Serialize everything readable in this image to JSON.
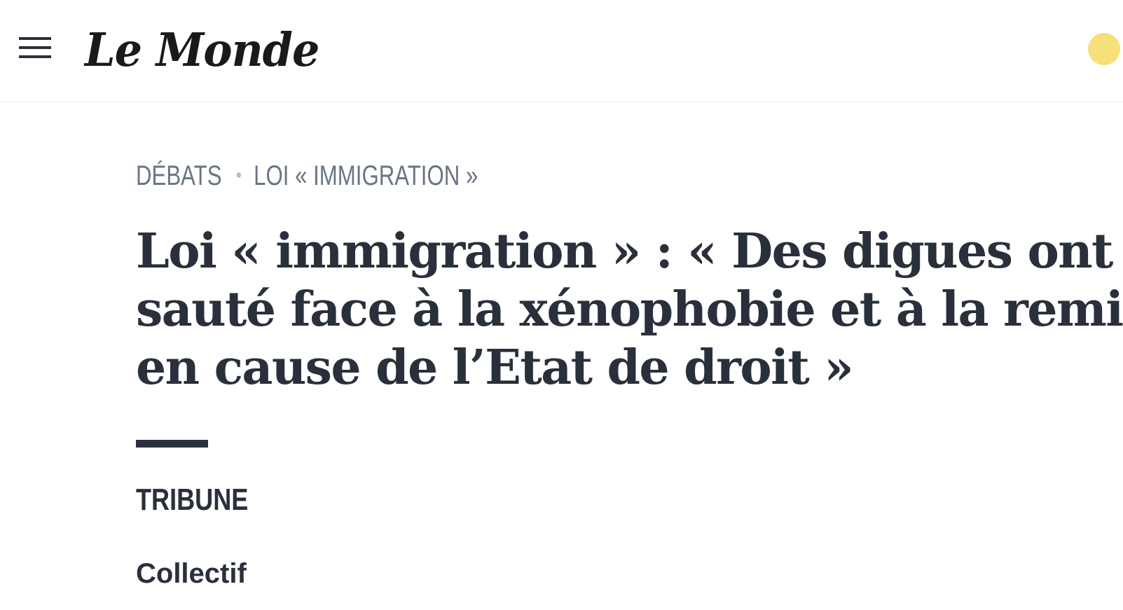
{
  "header": {
    "menu_icon": "hamburger-menu-icon",
    "logo_text": "Le Monde",
    "account_color": "#f7df7a"
  },
  "kicker": {
    "section": "DÉBATS",
    "separator": "•",
    "topic": "LOI « IMMIGRATION »",
    "color": "#6a7486"
  },
  "article": {
    "title_lines": [
      "Loi « immigration » : « Des digues ont",
      "sauté face à la xénophobie et à la remise",
      "en cause de l’Etat de droit »"
    ],
    "section_label": "TRIBUNE",
    "author": "Collectif",
    "text_color": "#2a303b"
  }
}
